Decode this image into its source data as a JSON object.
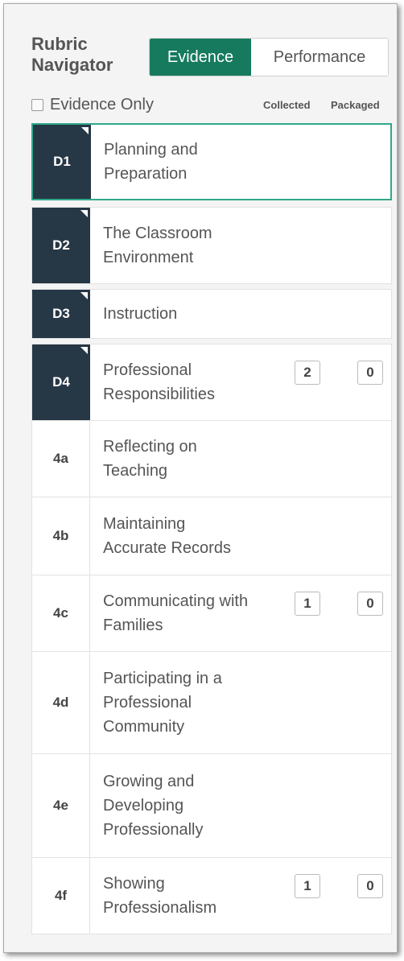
{
  "header": {
    "title_line1": "Rubric",
    "title_line2": "Navigator",
    "toggle": {
      "active": "Evidence",
      "inactive": "Performance"
    }
  },
  "filter": {
    "label": "Evidence Only",
    "checked": false
  },
  "columns": {
    "collected": "Collected",
    "packaged": "Packaged"
  },
  "domains": [
    {
      "code": "D1",
      "lines": [
        "Planning and",
        "Preparation"
      ],
      "selected": true
    },
    {
      "code": "D2",
      "lines": [
        "The Classroom",
        "Environment"
      ]
    },
    {
      "code": "D3",
      "lines": [
        "Instruction"
      ]
    },
    {
      "code": "D4",
      "lines": [
        "Professional",
        "Responsibilities"
      ],
      "collected": "2",
      "packaged": "0"
    }
  ],
  "components": [
    {
      "code": "4a",
      "lines": [
        "Reflecting on",
        "Teaching"
      ]
    },
    {
      "code": "4b",
      "lines": [
        "Maintaining",
        "Accurate Records"
      ]
    },
    {
      "code": "4c",
      "lines": [
        "Communicating with",
        "Families"
      ],
      "collected": "1",
      "packaged": "0"
    },
    {
      "code": "4d",
      "lines": [
        "Participating in a",
        "Professional",
        "Community"
      ]
    },
    {
      "code": "4e",
      "lines": [
        "Growing and",
        "Developing",
        "Professionally"
      ]
    },
    {
      "code": "4f",
      "lines": [
        "Showing",
        "Professionalism"
      ],
      "collected": "1",
      "packaged": "0"
    }
  ],
  "colors": {
    "accent": "#167a5e",
    "domain_bg": "#263746",
    "selected_border": "#2fa88a"
  }
}
